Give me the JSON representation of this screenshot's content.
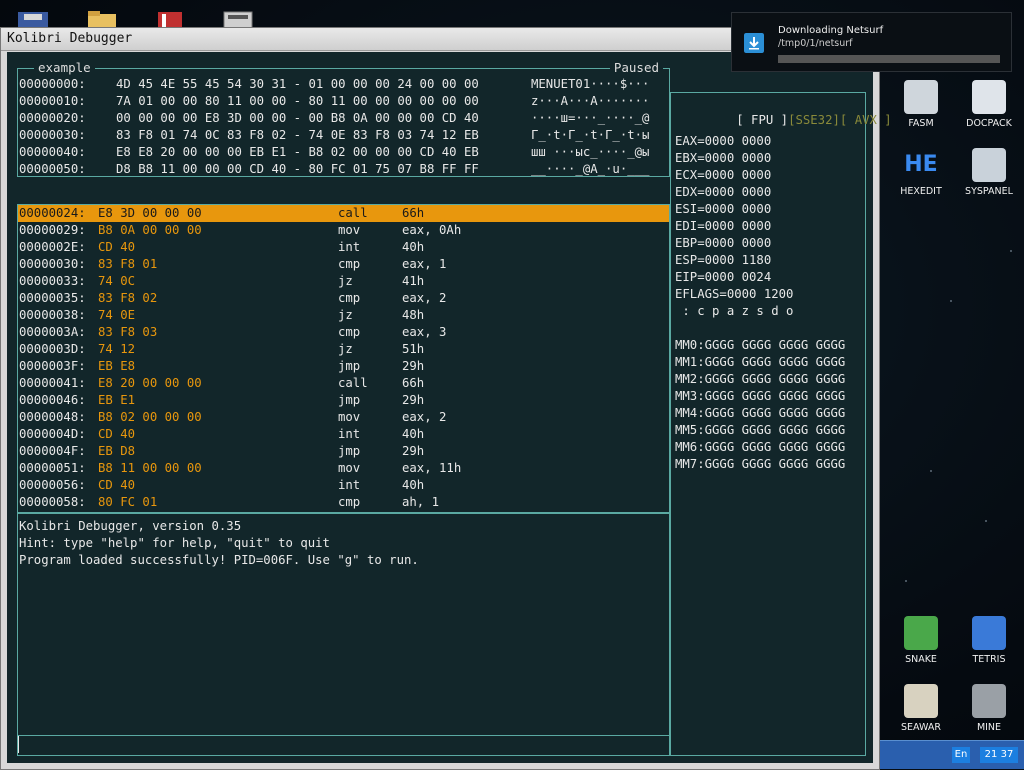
{
  "window": {
    "title": "Kolibri Debugger"
  },
  "memory_pane": {
    "label": "example",
    "status": "Paused",
    "rows": [
      {
        "addr": "00000000:",
        "hex": "4D 45 4E 55 45 54 30 31 - 01 00 00 00 24 00 00 00",
        "ascii": "MENUET01····$···"
      },
      {
        "addr": "00000010:",
        "hex": "7A 01 00 00 80 11 00 00 - 80 11 00 00 00 00 00 00",
        "ascii": "z···А···А·······"
      },
      {
        "addr": "00000020:",
        "hex": "00 00 00 00 E8 3D 00 00 - 00 B8 0A 00 00 00 CD 40",
        "ascii": "····ш=···_····_@"
      },
      {
        "addr": "00000030:",
        "hex": "83 F8 01 74 0C 83 F8 02 - 74 0E 83 F8 03 74 12 EB",
        "ascii": "Г_·t·Г_·t·Г_·t·ы"
      },
      {
        "addr": "00000040:",
        "hex": "E8 E8 20 00 00 00 EB E1 - B8 02 00 00 00 CD 40 EB",
        "ascii": "шш ···ыс_····_@ы"
      },
      {
        "addr": "00000050:",
        "hex": "D8 B8 11 00 00 00 CD 40 - 80 FC 01 75 07 B8 FF FF",
        "ascii": "__····_@А_·u·___"
      }
    ]
  },
  "disasm": {
    "rows": [
      {
        "addr": "00000024:",
        "bytes": "E8 3D 00 00 00",
        "mnem": "call",
        "ops": "66h"
      },
      {
        "addr": "00000029:",
        "bytes": "B8 0A 00 00 00",
        "mnem": "mov",
        "ops": "eax, 0Ah"
      },
      {
        "addr": "0000002E:",
        "bytes": "CD 40",
        "mnem": "int",
        "ops": "40h"
      },
      {
        "addr": "00000030:",
        "bytes": "83 F8 01",
        "mnem": "cmp",
        "ops": "eax, 1"
      },
      {
        "addr": "00000033:",
        "bytes": "74 0C",
        "mnem": "jz",
        "ops": "41h"
      },
      {
        "addr": "00000035:",
        "bytes": "83 F8 02",
        "mnem": "cmp",
        "ops": "eax, 2"
      },
      {
        "addr": "00000038:",
        "bytes": "74 0E",
        "mnem": "jz",
        "ops": "48h"
      },
      {
        "addr": "0000003A:",
        "bytes": "83 F8 03",
        "mnem": "cmp",
        "ops": "eax, 3"
      },
      {
        "addr": "0000003D:",
        "bytes": "74 12",
        "mnem": "jz",
        "ops": "51h"
      },
      {
        "addr": "0000003F:",
        "bytes": "EB E8",
        "mnem": "jmp",
        "ops": "29h"
      },
      {
        "addr": "00000041:",
        "bytes": "E8 20 00 00 00",
        "mnem": "call",
        "ops": "66h"
      },
      {
        "addr": "00000046:",
        "bytes": "EB E1",
        "mnem": "jmp",
        "ops": "29h"
      },
      {
        "addr": "00000048:",
        "bytes": "B8 02 00 00 00",
        "mnem": "mov",
        "ops": "eax, 2"
      },
      {
        "addr": "0000004D:",
        "bytes": "CD 40",
        "mnem": "int",
        "ops": "40h"
      },
      {
        "addr": "0000004F:",
        "bytes": "EB D8",
        "mnem": "jmp",
        "ops": "29h"
      },
      {
        "addr": "00000051:",
        "bytes": "B8 11 00 00 00",
        "mnem": "mov",
        "ops": "eax, 11h"
      },
      {
        "addr": "00000056:",
        "bytes": "CD 40",
        "mnem": "int",
        "ops": "40h"
      },
      {
        "addr": "00000058:",
        "bytes": "80 FC 01",
        "mnem": "cmp",
        "ops": "ah, 1"
      }
    ]
  },
  "console": {
    "lines": [
      "Kolibri Debugger, version 0.35",
      "Hint: type \"help\" for help, \"quit\" to quit",
      "Program loaded successfully! PID=006F. Use \"g\" to run."
    ],
    "input_value": ""
  },
  "registers": {
    "tabs": [
      "[ FPU ]",
      "[SSE32]",
      "[ AVX ]"
    ],
    "gp": [
      "EAX=0000 0000",
      "EBX=0000 0000",
      "ECX=0000 0000",
      "EDX=0000 0000",
      "ESI=0000 0000",
      "EDI=0000 0000",
      "EBP=0000 0000",
      "ESP=0000 1180",
      "EIP=0000 0024",
      "EFLAGS=0000 1200",
      " : c p a z s d o"
    ],
    "mmx": [
      "MM0:GGGG GGGG GGGG GGGG",
      "MM1:GGGG GGGG GGGG GGGG",
      "MM2:GGGG GGGG GGGG GGGG",
      "MM3:GGGG GGGG GGGG GGGG",
      "MM4:GGGG GGGG GGGG GGGG",
      "MM5:GGGG GGGG GGGG GGGG",
      "MM6:GGGG GGGG GGGG GGGG",
      "MM7:GGGG GGGG GGGG GGGG"
    ]
  },
  "notification": {
    "title": "Downloading Netsurf",
    "path": "/tmp0/1/netsurf",
    "progress": 0
  },
  "desktop_icons": [
    {
      "label": "FASM",
      "icon": "fasm-icon"
    },
    {
      "label": "DOCPACK",
      "icon": "docpack-icon"
    },
    {
      "label": "HEXEDIT",
      "icon": "hexedit-icon"
    },
    {
      "label": "SYSPANEL",
      "icon": "syspanel-icon"
    },
    {
      "label": "SNAKE",
      "icon": "snake-icon"
    },
    {
      "label": "TETRIS",
      "icon": "tetris-icon"
    },
    {
      "label": "SEAWAR",
      "icon": "seawar-icon"
    },
    {
      "label": "MINE",
      "icon": "mine-icon"
    }
  ],
  "taskbar": {
    "lang": "En",
    "time": "21 37"
  },
  "colors": {
    "accent": "#e8970d",
    "pane_border": "#5aa9a2",
    "pane_bg": "#12262a"
  }
}
